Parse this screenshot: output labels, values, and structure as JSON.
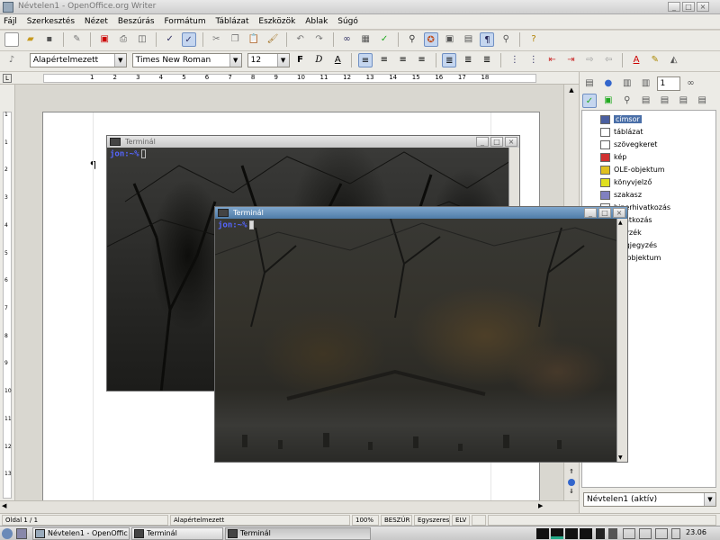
{
  "window": {
    "title": "Névtelen1 - OpenOffice.org Writer"
  },
  "menu": [
    "Fájl",
    "Szerkesztés",
    "Nézet",
    "Beszúrás",
    "Formátum",
    "Táblázat",
    "Eszközök",
    "Ablak",
    "Súgó"
  ],
  "formatting": {
    "paragraph_style": "Alapértelmezett",
    "font_name": "Times New Roman",
    "font_size": "12",
    "bold": "F",
    "italic": "D",
    "underline": "A"
  },
  "ruler": {
    "ticks": [
      "1",
      "2",
      "3",
      "4",
      "5",
      "6",
      "7",
      "8",
      "9",
      "10",
      "11",
      "12",
      "13",
      "14",
      "15",
      "16",
      "17",
      "18"
    ],
    "vticks": [
      "1",
      "1",
      "2",
      "3",
      "4",
      "5",
      "6",
      "7",
      "8",
      "9",
      "10",
      "11",
      "12",
      "13"
    ]
  },
  "navigator": {
    "page_number": "1",
    "items": [
      {
        "label": "címsor",
        "icon": "heading-icon",
        "color": "#4a5fa0"
      },
      {
        "label": "táblázat",
        "icon": "table-icon",
        "color": "#ffffff"
      },
      {
        "label": "szövegkeret",
        "icon": "frame-icon",
        "color": "#ffffff"
      },
      {
        "label": "kép",
        "icon": "image-icon",
        "color": "#d03030"
      },
      {
        "label": "OLE-objektum",
        "icon": "ole-icon",
        "color": "#e0c020"
      },
      {
        "label": "könyvjelző",
        "icon": "bookmark-icon",
        "color": "#e0e020"
      },
      {
        "label": "szakasz",
        "icon": "section-icon",
        "color": "#8080c0"
      },
      {
        "label": "hiperhivatkozás",
        "icon": "hyperlink-icon",
        "color": "#ffffff"
      },
      {
        "label": "hivatkozás",
        "icon": "reference-icon",
        "color": "#ffffff"
      },
      {
        "label": "jegyzék",
        "icon": "index-icon",
        "color": "#ffffff"
      },
      {
        "label": "megjegyzés",
        "icon": "comment-icon",
        "color": "#ffffff"
      },
      {
        "label": "rajzobjektum",
        "icon": "drawing-icon",
        "color": "#ffffff"
      }
    ],
    "document_select": "Névtelen1 (aktív)"
  },
  "statusbar": {
    "page": "Oldal 1 / 1",
    "style": "Alapértelmezett",
    "zoom": "100%",
    "insert_mode": "BESZÚR",
    "selection_mode": "Egyszeres",
    "signature": "ELV"
  },
  "terminal1": {
    "title": "Terminál",
    "prompt": "jon:~%"
  },
  "terminal2": {
    "title": "Terminál",
    "prompt": "jon:~%"
  },
  "taskbar": {
    "tasks": [
      "Névtelen1 - OpenOffic",
      "Terminál",
      "Terminál"
    ],
    "clock": "23.06"
  },
  "colors": {
    "titlebar_active": "#5d88b2",
    "terminal_bg": "#2e2e2b"
  }
}
